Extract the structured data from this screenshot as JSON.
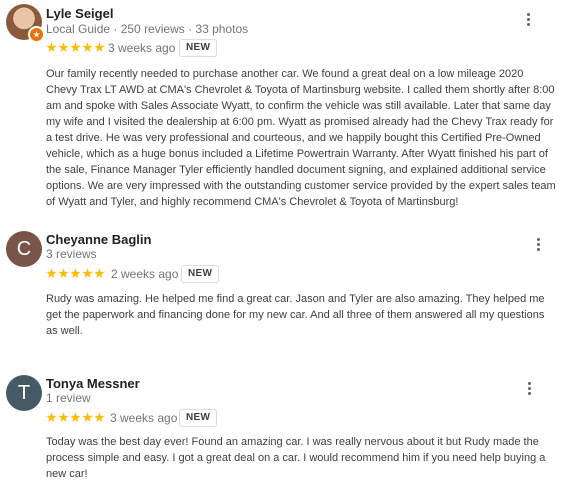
{
  "reviews": [
    {
      "name": "Lyle Seigel",
      "meta": "Local Guide · 250 reviews · 33 photos",
      "avatar_letter": "",
      "avatar_color": "#8a5a3c",
      "rating": 5,
      "time": "3 weeks ago",
      "badge": "NEW",
      "text": "Our family recently needed to purchase another car. We found a great deal on a low mileage 2020 Chevy Trax LT AWD at CMA's Chevrolet & Toyota of Martinsburg website. I called them shortly after 8:00 am and spoke with Sales Associate Wyatt, to confirm the vehicle was still available. Later that same day my wife and I visited the dealership at 6:00 pm. Wyatt as promised already had the Chevy Trax ready for a test drive. He was very professional and courteous, and we happily bought this Certified Pre-Owned vehicle, which as a huge bonus included a Lifetime Powertrain Warranty. After Wyatt finished his part of the sale, Finance Manager Tyler efficiently handled document signing, and explained additional service options. We are very impressed with the outstanding customer service provided by the expert sales team of Wyatt and Tyler, and highly recommend CMA's Chevrolet & Toyota of Martinsburg!"
    },
    {
      "name": "Cheyanne Baglin",
      "meta": "3 reviews",
      "avatar_letter": "C",
      "avatar_color": "#795548",
      "rating": 5,
      "time": "2 weeks ago",
      "badge": "NEW",
      "text": "Rudy was amazing. He helped me find a great car. Jason and Tyler are also amazing. They helped me get the paperwork and financing done for my new car. And all three of them answered all my questions as well."
    },
    {
      "name": "Tonya Messner",
      "meta": "1 review",
      "avatar_letter": "T",
      "avatar_color": "#455a64",
      "rating": 5,
      "time": "3 weeks ago",
      "badge": "NEW",
      "text": "Today was the best day ever! Found an amazing car. I was really nervous about it but Rudy made the process simple and easy. I got a great deal on a car.  I would recommend him if you need help buying a new car!"
    }
  ],
  "icons": {
    "star": "star-icon",
    "more": "more-vert-icon",
    "local_guide_badge": "local-guide-badge-icon"
  },
  "colors": {
    "star": "#fbbc04",
    "local_guide": "#e8710a"
  }
}
